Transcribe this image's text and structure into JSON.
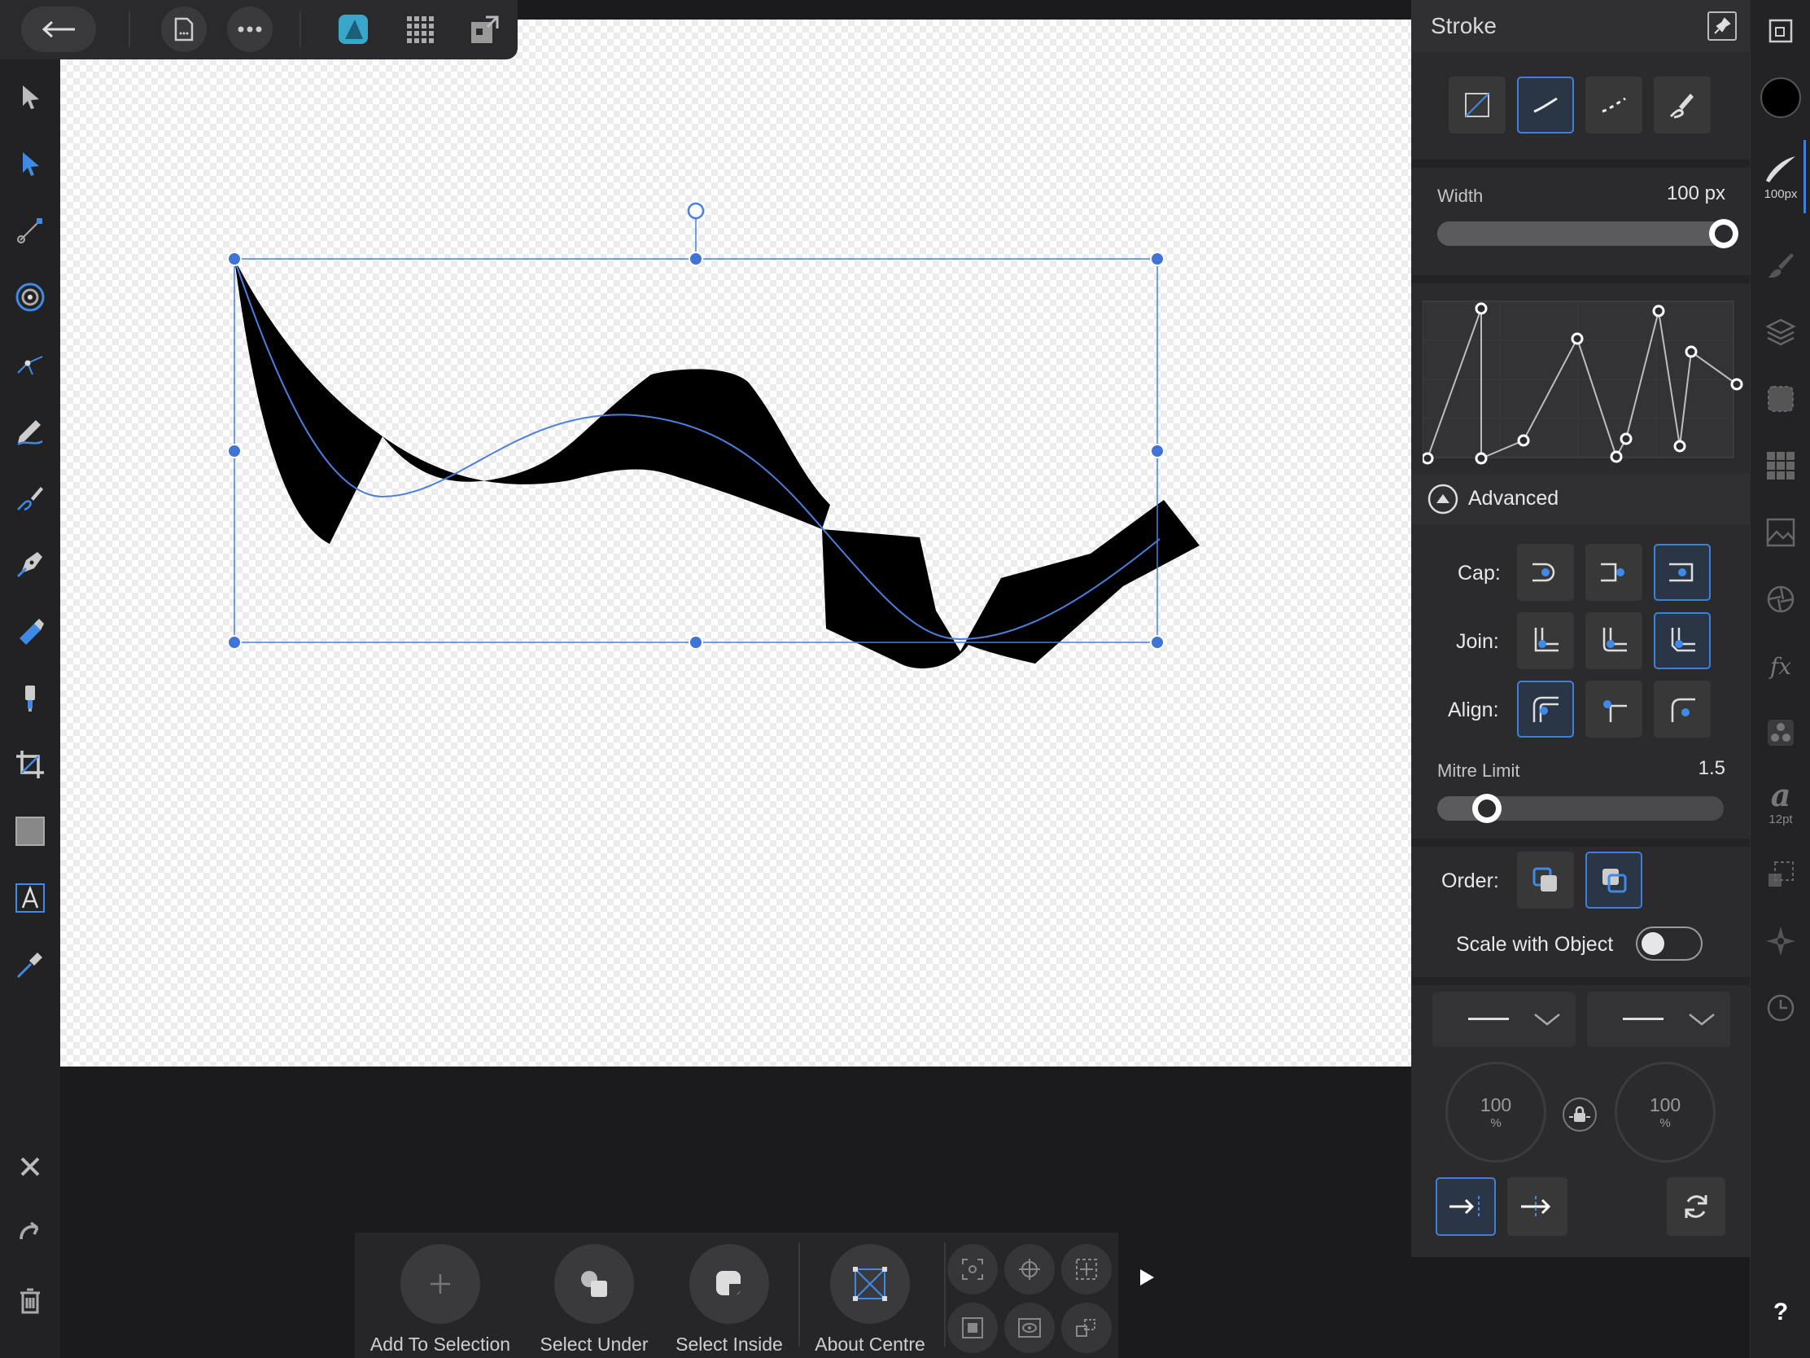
{
  "toolbar": {
    "back": "back-arrow",
    "items": [
      "document-icon",
      "more-icon",
      "designer-persona-icon",
      "pixel-persona-icon",
      "export-persona-icon"
    ]
  },
  "left_tools": [
    "move-tool",
    "node-tool",
    "contour-tool",
    "corner-tool",
    "point-transform-tool",
    "pencil-tool",
    "vector-brush-tool",
    "pen-tool",
    "fill-tool",
    "transparency-tool",
    "crop-tool",
    "rectangle-tool",
    "text-tool",
    "color-picker-tool"
  ],
  "left_bottom": [
    "close",
    "undo",
    "delete"
  ],
  "panel": {
    "title": "Stroke",
    "width_label": "Width",
    "width_value": "100 px",
    "width_fraction": 1.0,
    "advanced_label": "Advanced",
    "cap_label": "Cap:",
    "join_label": "Join:",
    "align_label": "Align:",
    "mitre_label": "Mitre Limit",
    "mitre_value": "1.5",
    "order_label": "Order:",
    "scale_label": "Scale with Object",
    "scale_on": false,
    "start_pct": "100",
    "end_pct": "100",
    "pct_unit": "%"
  },
  "studio": {
    "brush_size": "100px",
    "font_size": "12pt",
    "help": "?",
    "fx": "fx"
  },
  "context": {
    "add_to_selection": "Add To Selection",
    "select_under": "Select Under",
    "select_inside": "Select Inside",
    "about_centre": "About Centre"
  },
  "colors": {
    "accent": "#3f80d8",
    "panel_bg": "#2b2b2e",
    "canvas_bg": "#ffffff",
    "stroke_color": "#000000"
  }
}
